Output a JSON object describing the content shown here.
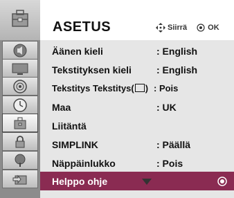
{
  "title": "ASETUS",
  "nav_hint": {
    "move_icon": "four-way-arrows-icon",
    "move_label": "Siirrä",
    "ok_icon": "ok-circle-icon",
    "ok_label": "OK"
  },
  "side_icons": [
    "setup-toolbox-icon",
    "audio-speaker-icon",
    "picture-screen-icon",
    "disc-icon",
    "clock-icon",
    "setup-toolbox-icon",
    "lock-icon",
    "tree-icon",
    "input-icon"
  ],
  "active_side_icon": 4,
  "menu": {
    "items": [
      {
        "label": "Äänen kieli",
        "value": ": English"
      },
      {
        "label": "Tekstityksen kieli",
        "value": ": English"
      },
      {
        "label": "Tekstitys  Tekstitys(",
        "label_suffix": ")",
        "value": ": Pois",
        "icon": "subtitle-box-icon"
      },
      {
        "label": "Maa",
        "value": ": UK"
      },
      {
        "label": "Liitäntä",
        "value": ""
      },
      {
        "label": "SIMPLINK",
        "value": ": Päällä"
      },
      {
        "label": "Näppäinlukko",
        "value": ": Pois"
      },
      {
        "label": "Helppo ohje",
        "value": "",
        "selected": true
      }
    ],
    "more_indicator": "down-arrow-icon"
  },
  "colors": {
    "selected_row": "#8a2b52",
    "menu_bg": "#e6e6e6",
    "side_strip": "#8c8c8c"
  }
}
